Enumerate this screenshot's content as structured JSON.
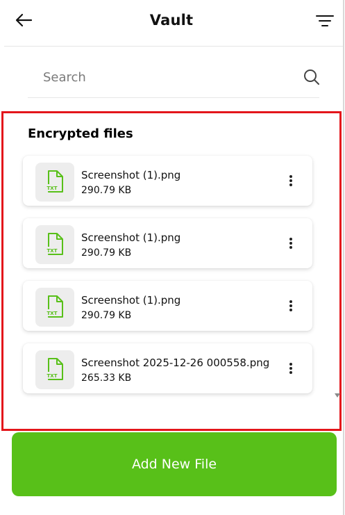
{
  "header": {
    "title": "Vault",
    "back_icon": "arrow-left-icon",
    "filter_icon": "filter-lines-icon"
  },
  "search": {
    "placeholder": "Search",
    "value": "",
    "icon": "search-icon"
  },
  "section": {
    "title": "Encrypted files"
  },
  "files": [
    {
      "name": "Screenshot (1).png",
      "size": "290.79 KB",
      "icon": "txt-file-icon"
    },
    {
      "name": "Screenshot (1).png",
      "size": "290.79 KB",
      "icon": "txt-file-icon"
    },
    {
      "name": "Screenshot (1).png",
      "size": "290.79 KB",
      "icon": "txt-file-icon"
    },
    {
      "name": "Screenshot 2025-12-26 000558.png",
      "size": "265.33 KB",
      "icon": "txt-file-icon"
    }
  ],
  "file_icon_label": "TXT",
  "add_button": {
    "label": "Add New File"
  },
  "colors": {
    "accent": "#58c019",
    "highlight_border": "#e3161b",
    "thumb_bg": "#ededed"
  }
}
